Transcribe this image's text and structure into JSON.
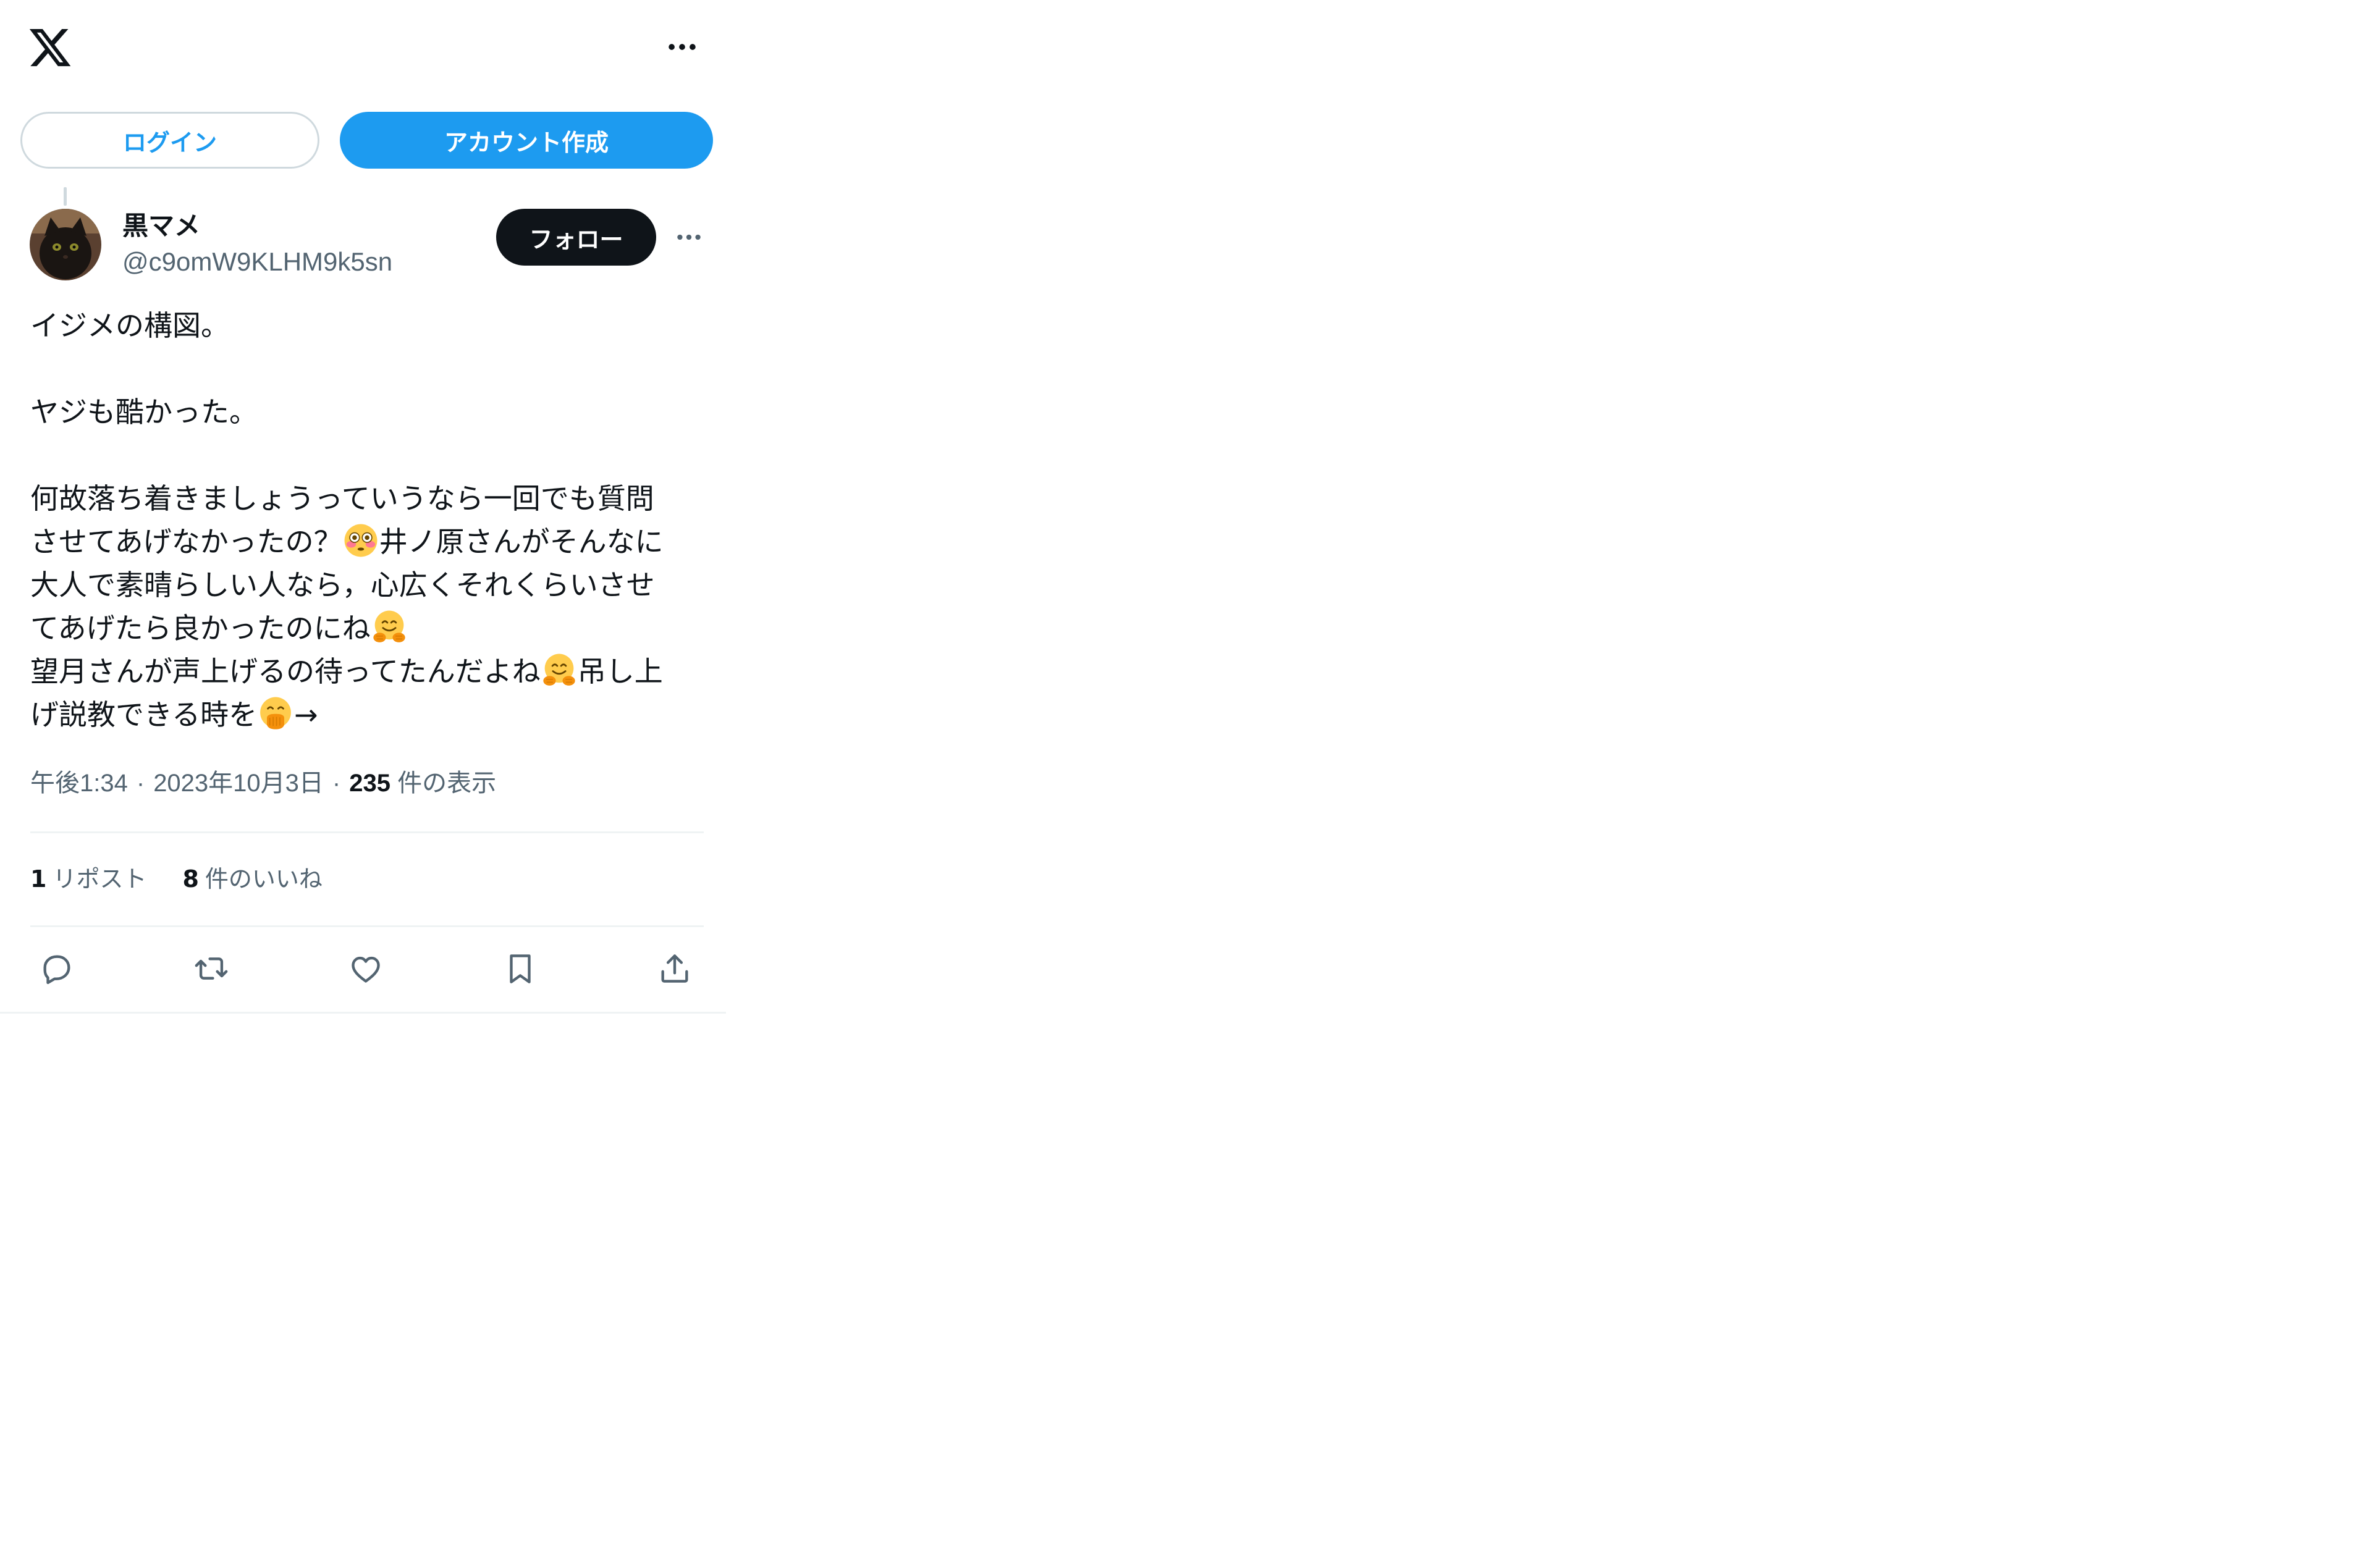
{
  "header": {
    "logo_icon": "x-logo-icon",
    "more_icon": "more-horizontal-icon"
  },
  "auth": {
    "login_label": "ログイン",
    "signup_label": "アカウント作成"
  },
  "post": {
    "author": {
      "name": "黒マメ",
      "handle": "@c9omW9KLHM9k5sn",
      "avatar_icon": "black-cat-avatar"
    },
    "follow_label": "フォロー",
    "lines": [
      [
        "イジメの構図。"
      ],
      [
        ""
      ],
      [
        "ヤジも酷かった。"
      ],
      [
        ""
      ],
      [
        "何故落ち着きましょうっていうなら一回でも質問"
      ],
      [
        "させてあげなかったの？",
        {
          "emoji": "flushed-face-emoji"
        },
        "井ノ原さんがそんなに"
      ],
      [
        "大人で素晴らしい人なら，心広くそれくらいさせ"
      ],
      [
        "てあげたら良かったのにね",
        {
          "emoji": "hugging-face-emoji"
        }
      ],
      [
        "望月さんが声上げるの待ってたんだよね",
        {
          "emoji": "hugging-face-emoji"
        },
        "吊し上"
      ],
      [
        "げ説教できる時を",
        {
          "emoji": "face-with-hand-over-mouth-emoji"
        },
        "→"
      ]
    ],
    "meta": {
      "time": "午後1:34",
      "date": "2023年10月3日",
      "views_count": "235",
      "views_label": "件の表示",
      "separator": "·"
    },
    "stats": {
      "reposts_count": "1",
      "reposts_label": "リポスト",
      "likes_count": "8",
      "likes_label": "件のいいね"
    },
    "actions": [
      "reply-icon",
      "repost-icon",
      "like-icon",
      "bookmark-icon",
      "share-icon"
    ]
  },
  "colors": {
    "accent": "#1d9bf0",
    "text_primary": "#0f1419",
    "text_secondary": "#536471",
    "border": "#cfd9de",
    "divider": "#eff3f4"
  }
}
